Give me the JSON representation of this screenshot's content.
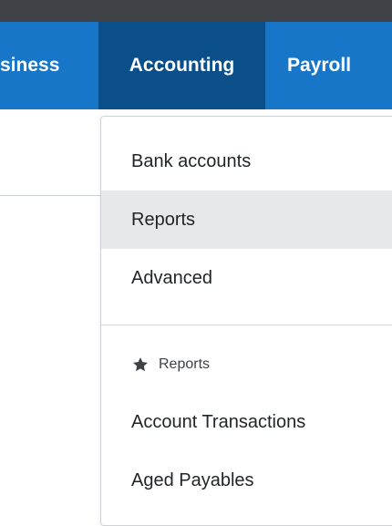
{
  "nav": {
    "items": [
      {
        "label": "siness"
      },
      {
        "label": "Accounting"
      },
      {
        "label": "Payroll"
      }
    ],
    "active": "Accounting"
  },
  "dropdown": {
    "items": [
      {
        "label": "Bank accounts"
      },
      {
        "label": "Reports"
      },
      {
        "label": "Advanced"
      }
    ],
    "hovered": "Reports",
    "section": {
      "label": "Reports",
      "icon": "star-icon",
      "items": [
        {
          "label": "Account Transactions"
        },
        {
          "label": "Aged Payables"
        }
      ]
    }
  },
  "colors": {
    "navbar": "#1876c8",
    "nav_active": "#0b4f8a",
    "topstrip": "#3f4347",
    "hover": "#e6e8ea"
  }
}
